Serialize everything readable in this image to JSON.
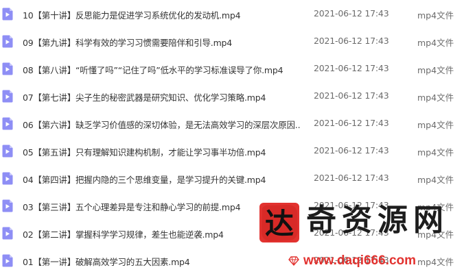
{
  "file_list": {
    "rows": [
      {
        "icon": "video-file-icon",
        "name": "10【第十讲】反思能力是促进学习系统优化的发动机.mp4",
        "date": "2021-06-12 17:43",
        "type": "mp4文件"
      },
      {
        "icon": "video-file-icon",
        "name": "09【第九讲】科学有效的学习习惯需要陪伴和引导.mp4",
        "date": "2021-06-12 17:43",
        "type": "mp4文件"
      },
      {
        "icon": "video-file-icon",
        "name": "08【第八讲】“听懂了吗”“记住了吗”低水平的学习标准误导了你.mp4",
        "date": "2021-06-12 17:43",
        "type": "mp4文件"
      },
      {
        "icon": "video-file-icon",
        "name": "07【第七讲】尖子生的秘密武器是研究知识、优化学习策略.mp4",
        "date": "2021-06-12 17:43",
        "type": "mp4文件"
      },
      {
        "icon": "video-file-icon",
        "name": "06【第六讲】缺乏学习价值感的深切体验，是无法高效学习的深层次原因...",
        "date": "2021-06-12 17:43",
        "type": "mp4文件"
      },
      {
        "icon": "video-file-icon",
        "name": "05【第五讲】只有理解知识建构机制，才能让学习事半功倍.mp4",
        "date": "2021-06-12 17:43",
        "type": "mp4文件"
      },
      {
        "icon": "video-file-icon",
        "name": "04【第四讲】把握内隐的三个思维变量，是学习提升的关键.mp4",
        "date": "2021-06-12 17:43",
        "type": "mp4文件"
      },
      {
        "icon": "video-file-icon",
        "name": "03【第三讲】五个心理差异是专注和静心学习的前提.mp4",
        "date": "2021-06-12 17:43",
        "type": "mp4文件"
      },
      {
        "icon": "video-file-icon",
        "name": "02【第二讲】掌握科学学习规律，差生也能逆袭.mp4",
        "date": "2021-06-12 17:43",
        "type": "mp4文件"
      },
      {
        "icon": "video-file-icon",
        "name": "01【第一讲】破解高效学习的五大因素.mp4",
        "date": "2021-06-12 17:43",
        "type": "mp4文件"
      }
    ]
  },
  "watermark": {
    "seal_char": "达",
    "brand_text": "奇资源网",
    "url": "www.daqi666.com",
    "seal_color": "#e2322f",
    "url_color": "#e2322f"
  },
  "colors": {
    "icon_fill": "#8e8ef5",
    "name_text": "#333333",
    "meta_text": "#6b6b6b"
  }
}
